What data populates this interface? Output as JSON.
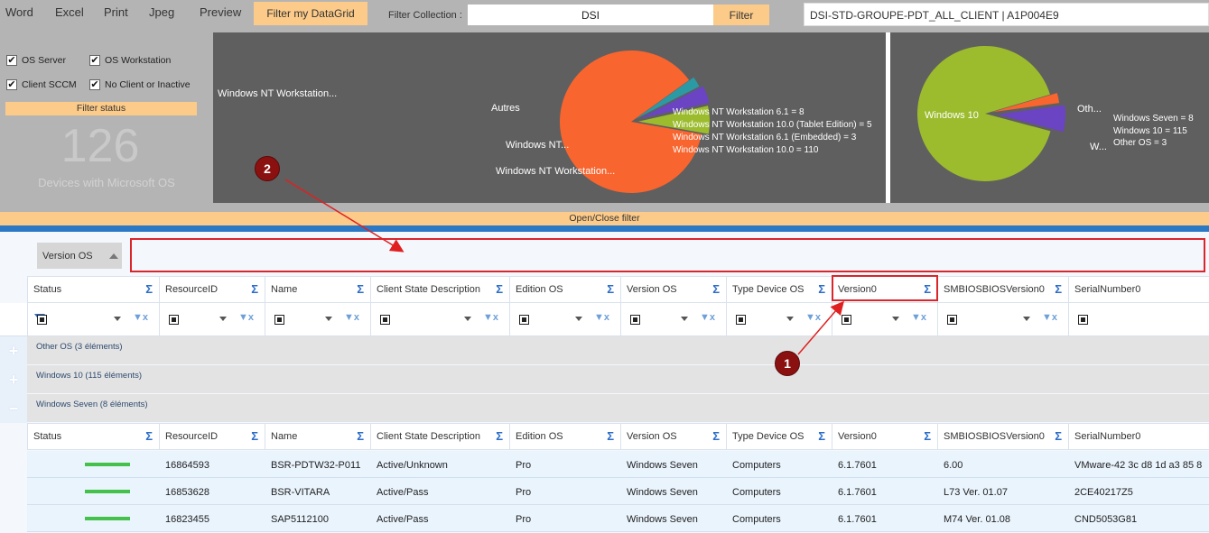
{
  "menu": {
    "word": "Word",
    "excel": "Excel",
    "print": "Print",
    "jpeg": "Jpeg",
    "preview": "Preview",
    "filter_grid": "Filter my DataGrid",
    "filter_collection_label": "Filter Collection :",
    "collection_value": "DSI",
    "filter_button": "Filter",
    "collection_name": "DSI-STD-GROUPE-PDT_ALL_CLIENT  |  A1P004E9"
  },
  "left_panel": {
    "checkboxes": [
      {
        "label": "OS Server",
        "checked": true
      },
      {
        "label": "OS Workstation",
        "checked": true
      },
      {
        "label": "Client SCCM",
        "checked": true
      },
      {
        "label": "No Client or Inactive",
        "checked": true
      }
    ],
    "check_mark": "✔",
    "filter_status": "Filter status",
    "count": "126",
    "count_label": "Devices with Microsoft OS"
  },
  "chart_data": [
    {
      "type": "pie",
      "slices": [
        {
          "label": "Windows NT Workstation...",
          "value": 110,
          "color": "#f8652f"
        },
        {
          "label": "Autres",
          "value": 3,
          "color": "#2b9aa5"
        },
        {
          "label": "Windows NT...",
          "value": 5,
          "color": "#6b44c4"
        },
        {
          "label": "Windows NT Workstation...",
          "value": 8,
          "color": "#9cbc2e"
        }
      ],
      "legend": [
        "Windows NT Workstation 6.1 = 8",
        "Windows NT Workstation 10.0 (Tablet Edition) = 5",
        "Windows NT Workstation 6.1 (Embedded) = 3",
        "Windows NT Workstation 10.0 = 110"
      ]
    },
    {
      "type": "pie",
      "slices": [
        {
          "label": "Windows 10",
          "value": 115,
          "color": "#9cbc2e"
        },
        {
          "label": "Oth...",
          "value": 3,
          "color": "#f8652f"
        },
        {
          "label": "W...",
          "value": 8,
          "color": "#6b44c4"
        }
      ],
      "legend": [
        "Windows Seven = 8",
        "Windows 10 = 115",
        "Other OS = 3"
      ]
    }
  ],
  "open_close": "Open/Close filter",
  "group_panel": {
    "chip": "Version OS"
  },
  "columns": [
    "Status",
    "ResourceID",
    "Name",
    "Client State Description",
    "Edition OS",
    "Version OS",
    "Type Device OS",
    "Version0",
    "SMBIOSBIOSVersion0",
    "SerialNumber0"
  ],
  "sigma": "Σ",
  "funnel": "▼x",
  "expanders": [
    "+",
    "+",
    "−"
  ],
  "groups": [
    "Other OS (3 éléments)",
    "Windows 10 (115 éléments)",
    "Windows Seven (8 éléments)"
  ],
  "rows": [
    {
      "resource_id": "16864593",
      "name": "BSR-PDTW32-P011",
      "client_state": "Active/Unknown",
      "edition": "Pro",
      "version_os": "Windows Seven",
      "type": "Computers",
      "version0": "6.1.7601",
      "bios": "6.00",
      "serial": "VMware-42 3c d8 1d a3 85 8"
    },
    {
      "resource_id": "16853628",
      "name": "BSR-VITARA",
      "client_state": "Active/Pass",
      "edition": "Pro",
      "version_os": "Windows Seven",
      "type": "Computers",
      "version0": "6.1.7601",
      "bios": "L73 Ver. 01.07",
      "serial": "2CE40217Z5"
    },
    {
      "resource_id": "16823455",
      "name": "SAP5112100",
      "client_state": "Active/Pass",
      "edition": "Pro",
      "version_os": "Windows Seven",
      "type": "Computers",
      "version0": "6.1.7601",
      "bios": "M74 Ver. 01.08",
      "serial": "CND5053G81"
    }
  ],
  "callouts": {
    "one": "1",
    "two": "2"
  }
}
